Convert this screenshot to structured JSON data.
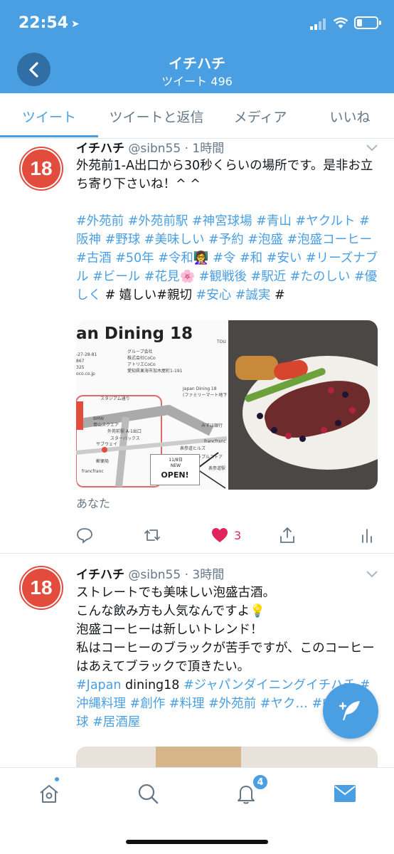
{
  "status_bar": {
    "time": "22:54"
  },
  "header": {
    "title": "イチハチ",
    "subtitle": "ツイート 496"
  },
  "tabs": [
    {
      "label": "ツイート"
    },
    {
      "label": "ツイートと返信"
    },
    {
      "label": "メディア"
    },
    {
      "label": "いいね"
    }
  ],
  "colors": {
    "accent": "#4a9fe3",
    "like": "#e0245e",
    "avatar": "#e34b3c"
  },
  "tweets": [
    {
      "avatar_text": "18",
      "name": "イチハチ",
      "meta": "@sibn55 · 1時間",
      "text": "外苑前1-A出口から30秒くらいの場所です。是非お立ち寄り下さいね！^ ^",
      "hashtags_line": "#外苑前 #外苑前駅 #神宮球場 #青山 #ヤクルト #阪神 #野球 #美味しい #予約 #泡盛 #泡盛コーヒー #古酒 #50年 #令和👩‍🏫 #令 #和 #安い #リーズナブル #ビール #花見🌸 #観戦後 #駅近 #たのしい #優しく",
      "plain_tail": "# 嬉しい#親切",
      "hashtags_tail": "#安心 #誠実",
      "trailing_hash": "#",
      "media": {
        "map_title": "an Dining 18",
        "map_phone_lines": "-27-28-81\n867\n325\noco.co.jp",
        "map_company": "グループ会社\n株式会社CoCo\nアトリエCoCo\n愛知県東海市加木屋町1-191",
        "map_label_stadium": "スタジアム通り",
        "map_label_bmw": "BMW\n青山スクエア",
        "map_label_station": "外苑前駅 A-1出口",
        "map_label_starbucks": "スターバックス",
        "map_label_subway": "サブウェイ",
        "map_label_post": "郵便局",
        "map_label_franc": "francfranc",
        "map_label_store": "Japan Dining 18\n(ファミリーマート地下1階)",
        "map_label_mizuho": "みずほ銀行",
        "map_label_hills": "表参道ヒルズ",
        "map_label_apple": "アップルストア",
        "map_label_omotesando": "表参道駅",
        "map_label_franc2": "francfranc",
        "map_label_tou": "TOU",
        "open_date": "11/8日\nNEW",
        "open_text": "OPEN!"
      },
      "retweet_label": "あなた",
      "likes": "3"
    },
    {
      "avatar_text": "18",
      "name": "イチハチ",
      "meta": "@sibn55 · 3時間",
      "line1": "ストレートでも美味しい泡盛古酒。",
      "line2": "こんな飲み方も人気なんですよ💡",
      "line3": "泡盛コーヒーは新しいトレンド！",
      "line4": "私はコーヒーのブラックが苦手ですが、このコーヒーはあえてブラックで頂きたい。",
      "tag_japan": "#Japan",
      "plain_dining": " dining18 ",
      "hashtags_line": "#ジャパンダイニングイチハチ #沖縄料理 #創作 #料理  #外苑前 #ヤク… #中日 #野球 #居酒屋"
    }
  ],
  "bottom_nav": [
    {
      "icon": "home-icon"
    },
    {
      "icon": "search-icon"
    },
    {
      "icon": "bell-icon",
      "badge": "4"
    },
    {
      "icon": "mail-icon"
    }
  ]
}
